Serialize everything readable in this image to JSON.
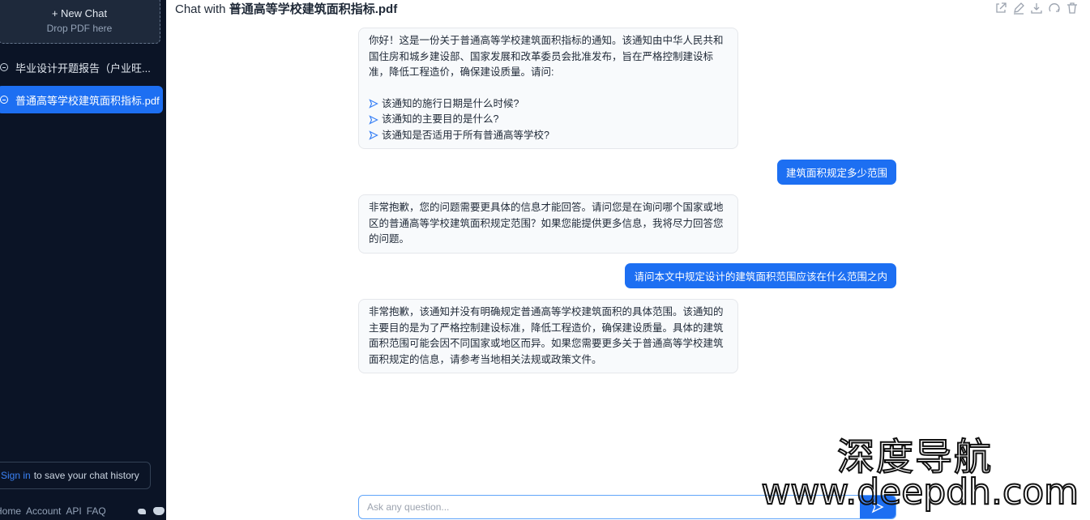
{
  "sidebar": {
    "new_chat_label": "+ New Chat",
    "new_chat_sub": "Drop PDF here",
    "chats": [
      {
        "label": "毕业设计开题报告（户业旺..."
      },
      {
        "label": "普通高等学校建筑面积指标.pdf"
      }
    ],
    "signin_link": "Sign in",
    "signin_text": "to save your chat history",
    "footer_links": [
      "Home",
      "Account",
      "API",
      "FAQ"
    ],
    "footer_icons": [
      "twitter-icon",
      "discord-icon"
    ]
  },
  "header": {
    "prefix": "Chat with ",
    "filename": "普通高等学校建筑面积指标.pdf",
    "icons": [
      "share-icon",
      "edit-icon",
      "download-icon",
      "refresh-icon",
      "trash-icon"
    ]
  },
  "messages": {
    "m1": {
      "intro": "你好！这是一份关于普通高等学校建筑面积指标的通知。该通知由中华人民共和国住房和城乡建设部、国家发展和改革委员会批准发布，旨在严格控制建设标准，降低工程造价，确保建设质量。请问:",
      "questions": [
        "该通知的施行日期是什么时候?",
        "该通知的主要目的是什么?",
        "该通知是否适用于所有普通高等学校?"
      ]
    },
    "u1": "建筑面积规定多少范围",
    "m2": "非常抱歉，您的问题需要更具体的信息才能回答。请问您是在询问哪个国家或地区的普通高等学校建筑面积规定范围？如果您能提供更多信息，我将尽力回答您的问题。",
    "u2": "请问本文中规定设计的建筑面积范围应该在什么范围之内",
    "m3": "非常抱歉，该通知并没有明确规定普通高等学校建筑面积的具体范围。该通知的主要目的是为了严格控制建设标准，降低工程造价，确保建设质量。具体的建筑面积范围可能会因不同国家或地区而异。如果您需要更多关于普通高等学校建筑面积规定的信息，请参考当地相关法规或政策文件。"
  },
  "input": {
    "placeholder": "Ask any question..."
  },
  "watermark": {
    "line1": "深度导航",
    "line2": "www.deepdh.com"
  },
  "colors": {
    "accent": "#1d6ff2",
    "sidebar_bg": "#0b1426"
  }
}
